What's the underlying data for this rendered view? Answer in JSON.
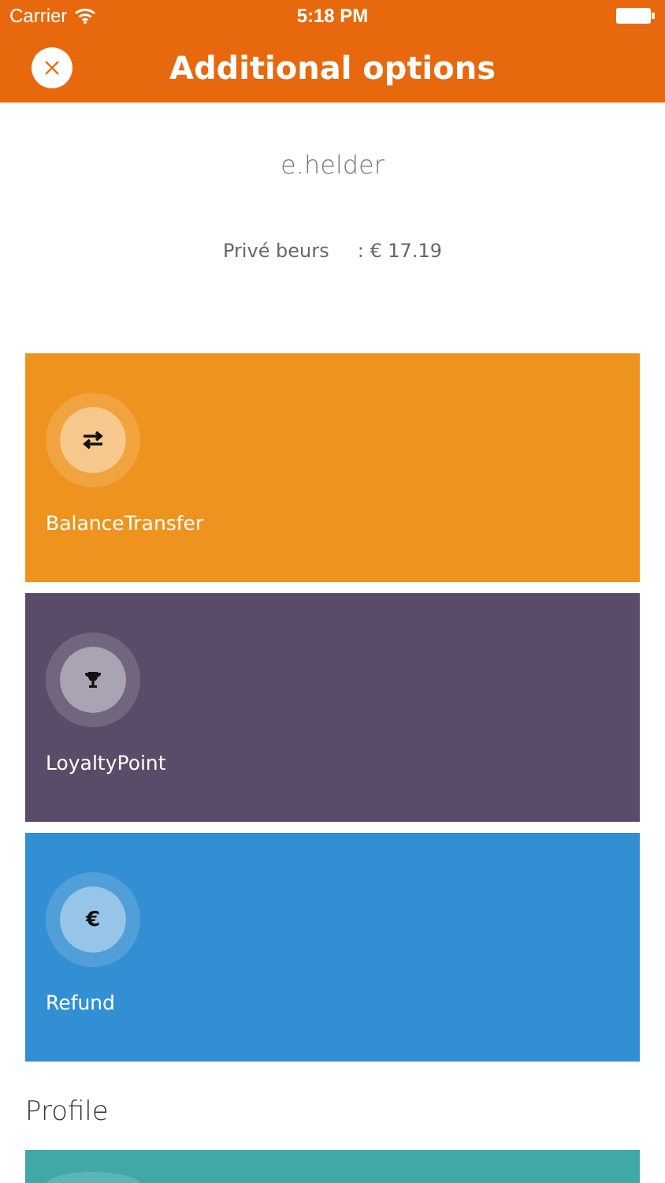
{
  "status_bar": {
    "carrier": "Carrier",
    "time": "5:18 PM"
  },
  "header": {
    "title": "Additional options"
  },
  "user": {
    "name": "e.helder",
    "balance_label": "Privé beurs",
    "balance_value": ": € 17.19"
  },
  "options": [
    {
      "kind": "transfer",
      "label": "BalanceTransfer",
      "color": "#ee931d"
    },
    {
      "kind": "trophy",
      "label": "LoyaltyPoint",
      "color": "#5a4c68"
    },
    {
      "kind": "symbol",
      "symbol": "€",
      "label": "Refund",
      "color": "#338fd3"
    }
  ],
  "profile": {
    "heading": "Profile",
    "cards": [
      {
        "kind": "blank",
        "color": "#41a8a8"
      }
    ]
  }
}
